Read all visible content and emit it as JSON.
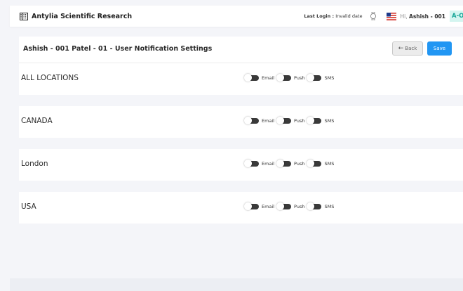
{
  "header": {
    "brand": "Antylia Scientific Research",
    "last_login_label": "Last Login :",
    "last_login_value": "Invalid date",
    "greeting": "Hi,",
    "user_name": "Ashish - 001",
    "avatar_initials": "A-O"
  },
  "page": {
    "title": "Ashish - 001 Patel - 01 - User Notification Settings",
    "back_label": "Back",
    "save_label": "Save"
  },
  "toggle_labels": {
    "email": "Email",
    "push": "Push",
    "sms": "SMS"
  },
  "locations": [
    {
      "name": "ALL LOCATIONS",
      "email": false,
      "push": false,
      "sms": false
    },
    {
      "name": "CANADA",
      "email": false,
      "push": false,
      "sms": false
    },
    {
      "name": "London",
      "email": false,
      "push": false,
      "sms": false
    },
    {
      "name": "USA",
      "email": false,
      "push": false,
      "sms": false
    }
  ],
  "colors": {
    "primary": "#2196f3",
    "avatar_bg": "#d4f5f0",
    "avatar_text": "#17a597",
    "toggle_track": "#3a3a3a"
  }
}
